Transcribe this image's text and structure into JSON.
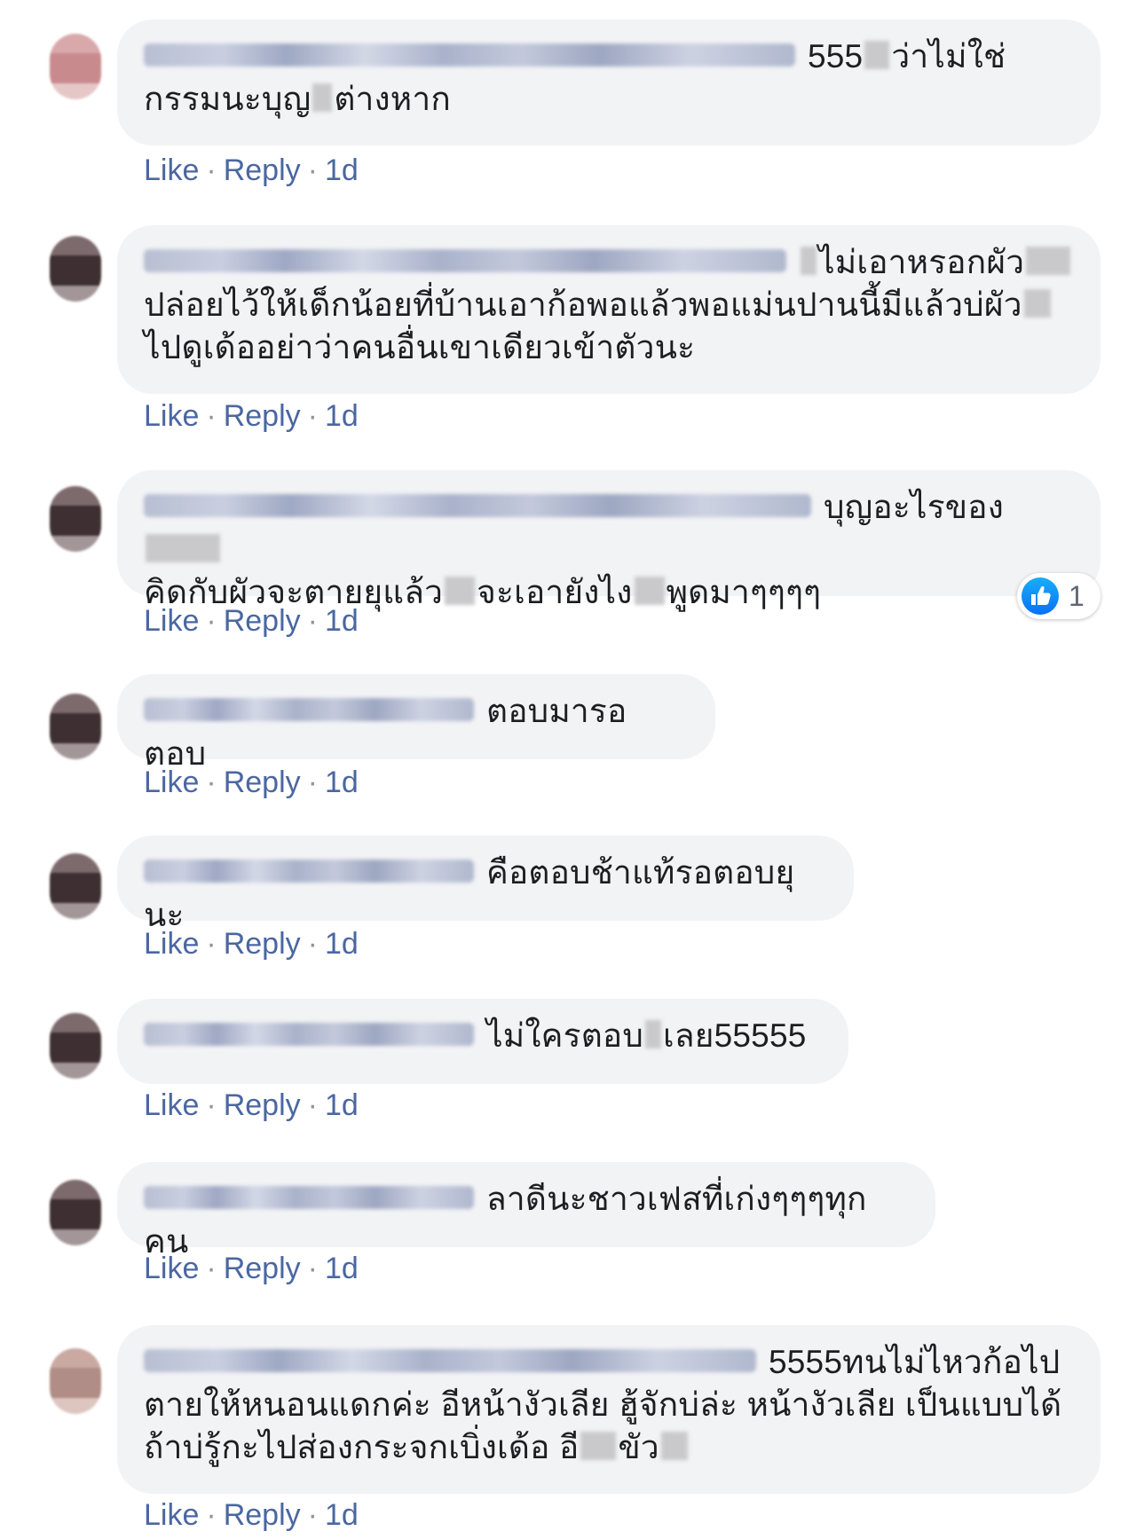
{
  "comments": [
    {
      "text_line1": "555",
      "text_line1b": "ว่าไม่ใช่",
      "text_line2a": "กรรมนะบุญ",
      "text_line2b": "ต่างหาก",
      "actions": {
        "like": "Like",
        "reply": "Reply",
        "time": "1d"
      }
    },
    {
      "text_line1": "ไม่เอาหรอกผัว",
      "text_line2": "ปล่อยไว้ให้เด็กน้อยที่บ้านเอาก้อพอแล้วพอแม่นปานนี้มีแล้วบ่ผัว",
      "text_line3": "ไปดูเด้ออย่าว่าคนอื่นเขาเดียวเข้าตัวนะ",
      "actions": {
        "like": "Like",
        "reply": "Reply",
        "time": "1d"
      }
    },
    {
      "text_line1": "บุญอะไรของ",
      "text_line2a": "คิดกับผัวจะตายยุแล้ว",
      "text_line2b": "จะเอายังไง",
      "text_line2c": "พูดมาๆๆๆๆ",
      "reaction": {
        "icon": "like-icon",
        "count": "1",
        "color": "#0a70f5"
      },
      "actions": {
        "like": "Like",
        "reply": "Reply",
        "time": "1d"
      }
    },
    {
      "text_line1": "ตอบมารอตอบ",
      "actions": {
        "like": "Like",
        "reply": "Reply",
        "time": "1d"
      }
    },
    {
      "text_line1": "คือตอบช้าแท้รอตอบยุนะ",
      "actions": {
        "like": "Like",
        "reply": "Reply",
        "time": "1d"
      }
    },
    {
      "text_line1a": "ไม่ใครตอบ",
      "text_line1b": "เลย55555",
      "actions": {
        "like": "Like",
        "reply": "Reply",
        "time": "1d"
      }
    },
    {
      "text_line1": "ลาดีนะชาวเฟสที่เก่งๆๆๆทุกคน",
      "actions": {
        "like": "Like",
        "reply": "Reply",
        "time": "1d"
      }
    },
    {
      "text_line1": "5555ทนไม่ไหวก้อไป",
      "text_line2": "ตายให้หนอนแดกค่ะ อีหน้างัวเลีย ฮู้จักบ่ล่ะ หน้างัวเลีย เป็นแบบได้",
      "text_line3a": "ถ้าบ่รู้กะไปส่องกระจกเบิ่งเด้อ อี",
      "text_line3b": "ขัว",
      "actions": {
        "like": "Like",
        "reply": "Reply",
        "time": "1d"
      }
    }
  ],
  "colors": {
    "link": "#4b67a1",
    "bubble": "#f2f3f5",
    "text": "#1c1e21",
    "separator": "#90949c"
  }
}
